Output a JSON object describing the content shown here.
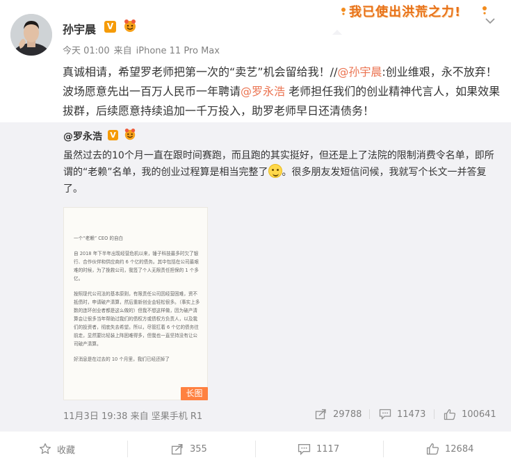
{
  "post": {
    "author": "孙宇晨",
    "v_badge": "V",
    "time": "今天 01:00",
    "source_prefix": "来自",
    "source": "iPhone 11 Pro Max",
    "text_1": "真诚相请，希望罗老师把第一次的“卖艺”机会留给我！",
    "text_repost_sep": "//",
    "mention_1": "@孙宇晨",
    "text_2": ":创业维艰，永不放弃！波场愿意先出一百万人民币一年聘请",
    "mention_2": "@罗永浩",
    "text_3": " 老师担任我们的创业精神代言人，如果效果拔群，后续愿意持续追加一千万投入，助罗老师早日还清债务！"
  },
  "sticker": {
    "text": "我已使出洪荒之力!"
  },
  "repost": {
    "author": "@罗永浩",
    "v_badge": "V",
    "text_1": "虽然过去的10个月一直在跟时间赛跑，而且跑的其实挺好，但还是上了法院的限制消费令名单，即所谓的“老赖”名单，我的创业过程算是相当完整了",
    "text_2": "。很多朋友发短信问候，我就写个长文一并答复了。",
    "long_image_tag": "长图",
    "date": "11月3日 19:38",
    "source_prefix": "来自",
    "source": "坚果手机 R1",
    "share_count": "29788",
    "comment_count": "11473",
    "like_count": "100641",
    "doc": {
      "title": "一个“老赖” CEO 的自白",
      "p1": "自 2018 年下半年出现经营危机以来，锤子科技最多时欠了银行、合作伙伴和供应商约 6 个亿的债务。其中包括在公司最艰难的时候，为了挽救公司，我签了个人无限责任担保的 1 个多亿。",
      "p2": "按照现代公司法的基本原则，有限责任公司因经营困难，资不抵债时，申请破产清算，然后重新创业会轻松很多。（事实上多数的连环创业者都是这么做的）但我不想这样做，因为破产清算会让很多当年帮助过我们的债权方或债权方负责人，以及我们的投资者，彻底失去希望。所以，尽管扛着 6 个亿的债务往前走，显然要比轻装上阵困难得多，但我也一直坚持没有让公司破产清算。",
      "p3": "好消息是在过去的 10 个月里，我们已经还掉了"
    }
  },
  "actions": {
    "favorite": "收藏",
    "share": "355",
    "comment": "1117",
    "like": "12684"
  },
  "colors": {
    "link": "#eb7350",
    "badge": "#f59b08",
    "long_tag": "#ff8140",
    "repost_bg": "#f2f2f5"
  }
}
